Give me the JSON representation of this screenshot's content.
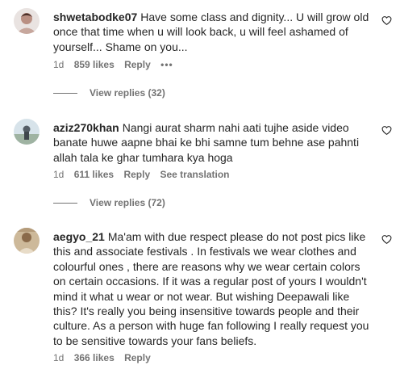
{
  "comments": [
    {
      "username": "shwetabodke07",
      "text": "Have some class and dignity... U will grow old once that time when u will look back, u will feel ashamed of yourself... Shame on you...",
      "time": "1d",
      "likes": "859 likes",
      "reply": "Reply",
      "more": "•••",
      "view_replies": "View replies (32)"
    },
    {
      "username": "aziz270khan",
      "text": "Nangi aurat sharm nahi aati tujhe aside video banate huwe aapne bhai ke bhi samne tum behne ase pahnti allah tala ke ghar tumhara kya hoga",
      "time": "1d",
      "likes": "611 likes",
      "reply": "Reply",
      "translate": "See translation",
      "view_replies": "View replies (72)"
    },
    {
      "username": "aegyo_21",
      "text": "Ma'am with due respect please do not post pics like this and associate festivals . In festivals we wear clothes and colourful ones , there are reasons why we wear certain colors on certain occasions. If it was a regular post of yours I wouldn't mind it what u wear or not wear. But wishing Deepawali like this? It's really you being insensitive towards people and their culture. As a person with huge fan following I really request you to be sensitive towards your fans beliefs.",
      "time": "1d",
      "likes": "366 likes",
      "reply": "Reply"
    }
  ],
  "icons": {
    "like": "heart-outline-icon"
  }
}
